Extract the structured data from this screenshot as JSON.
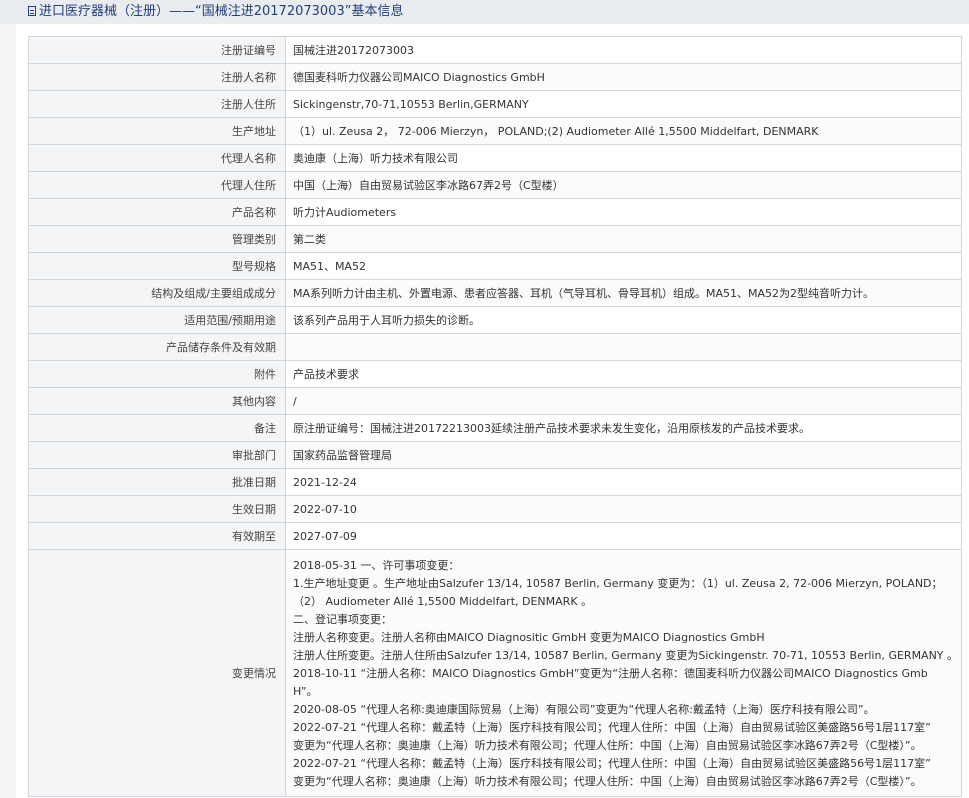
{
  "header": {
    "title": "进口医疗器械（注册）——“国械注进20172073003”基本信息"
  },
  "rows": [
    {
      "label": "注册证编号",
      "value": "国械注进20172073003"
    },
    {
      "label": "注册人名称",
      "value": "德国麦科听力仪器公司MAICO Diagnostics GmbH"
    },
    {
      "label": "注册人住所",
      "value": "Sickingenstr,70-71,10553 Berlin,GERMANY"
    },
    {
      "label": "生产地址",
      "value": "（1）ul. Zeusa 2， 72-006 Mierzyn， POLAND;(2) Audiometer Allé 1,5500 Middelfart, DENMARK"
    },
    {
      "label": "代理人名称",
      "value": "奥迪康（上海）听力技术有限公司"
    },
    {
      "label": "代理人住所",
      "value": "中国（上海）自由贸易试验区李冰路67弄2号（C型楼）"
    },
    {
      "label": "产品名称",
      "value": "听力计Audiometers"
    },
    {
      "label": "管理类别",
      "value": "第二类"
    },
    {
      "label": "型号规格",
      "value": "MA51、MA52"
    },
    {
      "label": "结构及组成/主要组成成分",
      "value": "MA系列听力计由主机、外置电源、患者应答器、耳机（气导耳机、骨导耳机）组成。MA51、MA52为2型纯音听力计。"
    },
    {
      "label": "适用范围/预期用途",
      "value": "该系列产品用于人耳听力损失的诊断。"
    },
    {
      "label": "产品储存条件及有效期",
      "value": ""
    },
    {
      "label": "附件",
      "value": "产品技术要求"
    },
    {
      "label": "其他内容",
      "value": "/"
    },
    {
      "label": "备注",
      "value": "原注册证编号：国械注进20172213003延续注册产品技术要求未发生变化，沿用原核发的产品技术要求。"
    },
    {
      "label": "审批部门",
      "value": "国家药品监督管理局"
    },
    {
      "label": "批准日期",
      "value": "2021-12-24"
    },
    {
      "label": "生效日期",
      "value": "2022-07-10"
    },
    {
      "label": "有效期至",
      "value": "2027-07-09"
    }
  ],
  "changes": {
    "label": "变更情况",
    "lines": [
      "2018-05-31 一、许可事项变更：",
      "1.生产地址变更 。生产地址由Salzufer 13/14, 10587 Berlin, Germany 变更为：（1）ul. Zeusa 2, 72-006 Mierzyn, POLAND；",
      "（2） Audiometer Allé 1,5500 Middelfart, DENMARK 。",
      "二、登记事项变更：",
      "注册人名称变更。注册人名称由MAICO Diagnositic GmbH 变更为MAICO Diagnostics GmbH",
      "注册人住所变更。注册人住所由Salzufer 13/14, 10587 Berlin, Germany 变更为Sickingenstr. 70-71, 10553 Berlin, GERMANY 。",
      "2018-10-11 “注册人名称：MAICO Diagnostics GmbH”变更为“注册人名称：德国麦科听力仪器公司MAICO Diagnostics Gmb",
      "H”。",
      "2020-08-05 “代理人名称:奥迪康国际贸易（上海）有限公司”变更为“代理人名称:戴孟特（上海）医疗科技有限公司”。",
      "2022-07-21 “代理人名称：戴孟特（上海）医疗科技有限公司；代理人住所：中国（上海）自由贸易试验区美盛路56号1层117室”",
      "变更为“代理人名称：奥迪康（上海）听力技术有限公司；代理人住所：中国（上海）自由贸易试验区李冰路67弄2号（C型楼）”。",
      "2022-07-21 “代理人名称：戴孟特（上海）医疗科技有限公司；代理人住所：中国（上海）自由贸易试验区美盛路56号1层117室”",
      "变更为“代理人名称：奥迪康（上海）听力技术有限公司；代理人住所：中国（上海）自由贸易试验区李冰路67弄2号（C型楼）”。"
    ]
  }
}
